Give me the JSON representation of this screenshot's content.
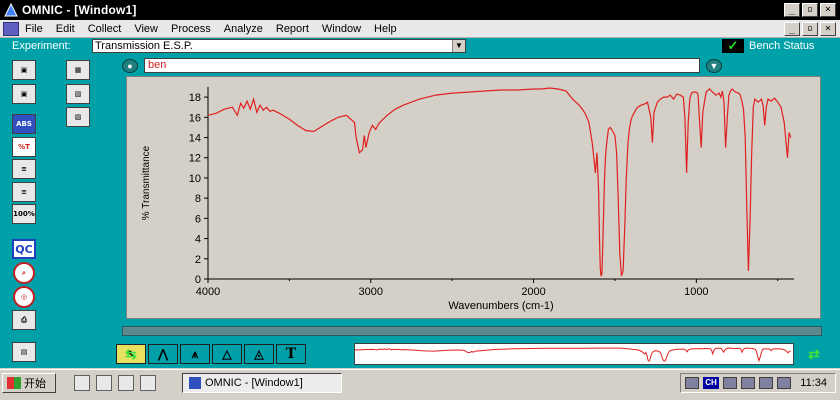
{
  "window": {
    "title": "OMNIC - [Window1]",
    "controls": [
      "_",
      "̲©",
      "×"
    ]
  },
  "menu": {
    "items": [
      {
        "label": "File"
      },
      {
        "label": "Edit"
      },
      {
        "label": "Collect"
      },
      {
        "label": "View"
      },
      {
        "label": "Process"
      },
      {
        "label": "Analyze"
      },
      {
        "label": "Report"
      },
      {
        "label": "Window"
      },
      {
        "label": "Help"
      }
    ]
  },
  "experiment": {
    "label": "Experiment:",
    "value": "Transmission E.S.P.",
    "bench_status": "Bench Status"
  },
  "spectrum": {
    "title": "ben"
  },
  "left_toolbar": {
    "icons": [
      "",
      "",
      "ABS",
      "%T",
      "",
      "",
      "100%",
      "",
      "QC",
      "",
      "",
      "",
      ""
    ]
  },
  "bottom_tools": {
    "t_label": "T"
  },
  "chart_data": {
    "type": "line",
    "title": "",
    "xlabel": "Wavenumbers (cm-1)",
    "ylabel": "% Transmittance",
    "xlim": [
      4000,
      400
    ],
    "ylim": [
      0,
      19
    ],
    "x_ticks": [
      "4000",
      "3000",
      "2000",
      "1000"
    ],
    "y_ticks": [
      "0",
      "2",
      "4",
      "6",
      "8",
      "10",
      "12",
      "14",
      "16",
      "18"
    ],
    "color": "#e02020",
    "series": [
      {
        "x": [
          4000,
          3950,
          3900,
          3850,
          3820,
          3800,
          3780,
          3760,
          3740,
          3720,
          3700,
          3680,
          3660,
          3640,
          3620,
          3600,
          3550,
          3500,
          3450,
          3400,
          3350,
          3300,
          3250,
          3200,
          3150,
          3100,
          3090,
          3070,
          3050,
          3040,
          3030,
          3010,
          2990,
          2970,
          2950,
          2900,
          2850,
          2800,
          2700,
          2600,
          2500,
          2400,
          2300,
          2200,
          2100,
          2000,
          1950,
          1900,
          1850,
          1800,
          1780,
          1760,
          1740,
          1720,
          1700,
          1680,
          1660,
          1640,
          1620,
          1610,
          1600,
          1595,
          1590,
          1585,
          1580,
          1575,
          1570,
          1565,
          1560,
          1555,
          1550,
          1545,
          1540,
          1530,
          1520,
          1500,
          1490,
          1480,
          1470,
          1460,
          1450,
          1440,
          1430,
          1420,
          1410,
          1400,
          1390,
          1380,
          1370,
          1360,
          1340,
          1320,
          1300,
          1280,
          1270,
          1260,
          1240,
          1220,
          1200,
          1180,
          1160,
          1150,
          1140,
          1120,
          1100,
          1080,
          1070,
          1060,
          1050,
          1040,
          1030,
          1020,
          1000,
          990,
          980,
          970,
          960,
          940,
          920,
          900,
          880,
          860,
          850,
          840,
          830,
          820,
          810,
          800,
          790,
          780,
          760,
          740,
          730,
          720,
          710,
          700,
          690,
          680,
          670,
          660,
          650,
          640,
          620,
          600,
          590,
          580,
          570,
          560,
          540,
          520,
          500,
          480,
          460,
          440,
          430,
          420
        ],
        "y": [
          16.2,
          16.4,
          16.8,
          17.0,
          16.2,
          17.4,
          16.9,
          17.6,
          16.8,
          17.8,
          16.5,
          17.2,
          16.7,
          17.0,
          16.6,
          16.7,
          16.3,
          15.8,
          15.2,
          14.7,
          14.6,
          15.1,
          15.6,
          16.0,
          16.2,
          15.5,
          14.0,
          12.5,
          12.8,
          14.2,
          13.0,
          14.5,
          15.2,
          14.8,
          15.4,
          16.2,
          16.8,
          17.2,
          17.8,
          18.2,
          18.4,
          18.5,
          18.6,
          18.7,
          18.7,
          18.8,
          18.8,
          18.9,
          18.8,
          18.6,
          18.2,
          17.8,
          17.5,
          17.2,
          16.8,
          16.3,
          15.5,
          13.5,
          10.5,
          12.5,
          8.5,
          4.0,
          1.0,
          0.3,
          0.5,
          3.0,
          6.5,
          9.5,
          11.5,
          12.8,
          13.5,
          14.2,
          14.8,
          15.0,
          14.8,
          14.2,
          12.5,
          8.0,
          2.5,
          0.3,
          0.8,
          5.0,
          10.0,
          13.5,
          15.0,
          15.8,
          16.2,
          16.5,
          16.8,
          17.0,
          17.2,
          17.3,
          17.5,
          16.0,
          13.5,
          16.5,
          17.5,
          17.8,
          18.0,
          18.0,
          18.2,
          18.0,
          17.8,
          18.3,
          18.2,
          18.0,
          16.0,
          10.5,
          15.5,
          17.8,
          18.4,
          18.5,
          18.5,
          18.3,
          15.5,
          13.0,
          16.5,
          18.5,
          18.8,
          18.5,
          18.2,
          18.4,
          18.0,
          18.6,
          17.5,
          13.0,
          16.0,
          18.2,
          18.6,
          18.8,
          18.5,
          18.4,
          18.2,
          17.6,
          16.8,
          14.0,
          7.0,
          0.8,
          6.0,
          12.5,
          17.0,
          17.8,
          17.5,
          17.8,
          17.2,
          15.2,
          17.0,
          17.8,
          17.6,
          17.9,
          17.5,
          17.0,
          15.5,
          12.0,
          14.5,
          14.0
        ]
      }
    ]
  }
}
